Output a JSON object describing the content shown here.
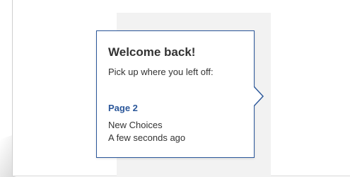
{
  "callout": {
    "title": "Welcome back!",
    "subtitle": "Pick up where you left off:",
    "page_link": "Page 2",
    "document_name": "New Choices",
    "timestamp": "A few seconds ago"
  },
  "colors": {
    "accent": "#2b579a",
    "text": "#333333",
    "page_bg": "#f2f2f2"
  }
}
